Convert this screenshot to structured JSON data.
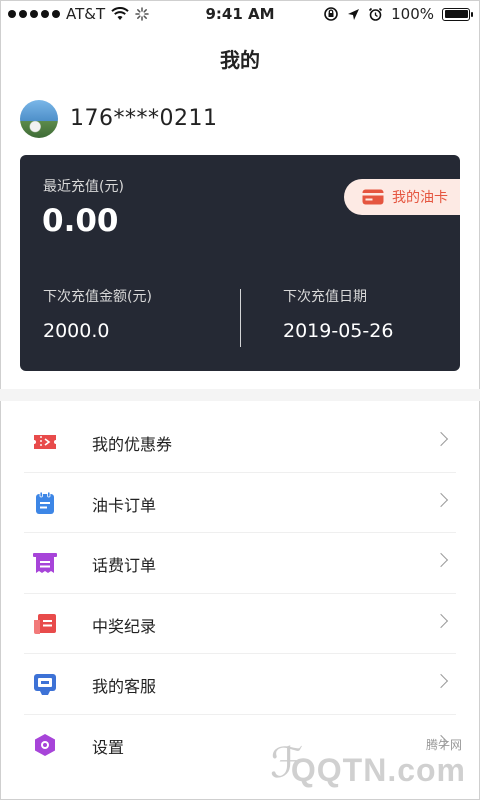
{
  "status_bar": {
    "carrier": "AT&T",
    "time": "9:41 AM",
    "battery_percent": "100%",
    "battery_level": 1.0
  },
  "header": {
    "title": "我的"
  },
  "profile": {
    "phone": "176****0211"
  },
  "card": {
    "recent_label": "最近充值(元)",
    "recent_value": "0.00",
    "my_card_label": "我的油卡",
    "next_amount_label": "下次充值金额(元)",
    "next_amount_value": "2000.0",
    "next_date_label": "下次充值日期",
    "next_date_value": "2019-05-26",
    "bg_color": "#252934",
    "accent_color": "#e5553f"
  },
  "menu": {
    "items": [
      {
        "label": "我的优惠券",
        "icon": "coupon-icon",
        "color": "#e84b4b"
      },
      {
        "label": "油卡订单",
        "icon": "notepad-icon",
        "color": "#3d86e6"
      },
      {
        "label": "话费订单",
        "icon": "receipt-icon",
        "color": "#a744d9"
      },
      {
        "label": "中奖纪录",
        "icon": "record-icon",
        "color": "#e84b4b"
      },
      {
        "label": "我的客服",
        "icon": "service-icon",
        "color": "#3d72d6"
      },
      {
        "label": "设置",
        "icon": "settings-icon",
        "color": "#a744d9"
      }
    ]
  },
  "watermark": {
    "small": "腾牛网",
    "big": "QQTN.com"
  }
}
